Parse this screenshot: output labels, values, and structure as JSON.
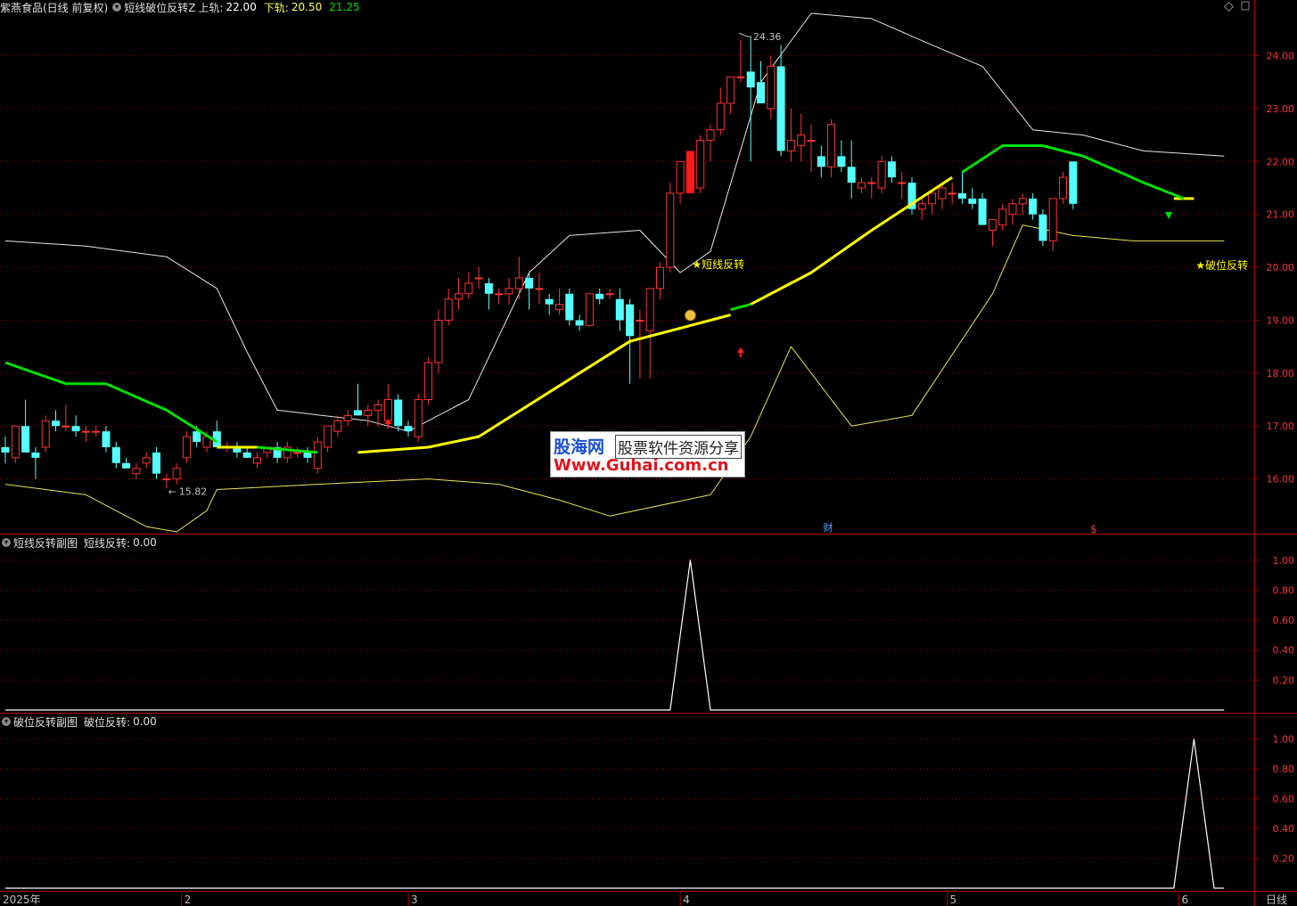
{
  "header": {
    "stock": "紫燕食品(日线 前复权)",
    "indicator": "短线破位反转Z",
    "upper_label": "上轨:",
    "upper_value": "22.00",
    "lower_label": "下轨:",
    "lower_value": "20.50",
    "mid_value": "21.25"
  },
  "sub1": {
    "title": "短线反转副图",
    "label": "短线反转:",
    "value": "0.00"
  },
  "sub2": {
    "title": "破位反转副图",
    "label": "破位反转:",
    "value": "0.00"
  },
  "annotations": {
    "high_label": "24.36",
    "low_label": "15.82",
    "signal1": "★短线反转",
    "signal2": "★破位反转",
    "cai": "财",
    "dollar": "$"
  },
  "timeline": {
    "year": "2025年",
    "months": [
      "2",
      "3",
      "4",
      "5",
      "6"
    ],
    "period": "日线"
  },
  "watermark": {
    "line1a": "股海网",
    "line1b": "股票软件资源分享",
    "line2": "Www.Guhai.com.cn"
  },
  "colors": {
    "up": "#ff3232",
    "down": "#54ffff",
    "grid": "#8b0000",
    "axis": "#b00000",
    "yellow": "#ffff00",
    "green": "#00e000"
  },
  "chart_data": [
    {
      "type": "candlestick",
      "ylim": [
        15.0,
        24.8
      ],
      "yticks": [
        16.0,
        17.0,
        18.0,
        19.0,
        20.0,
        21.0,
        22.0,
        23.0,
        24.0
      ],
      "candles": [
        [
          16.6,
          16.8,
          16.3,
          16.5
        ],
        [
          16.4,
          17.0,
          16.3,
          17.0
        ],
        [
          17.0,
          17.5,
          16.5,
          16.5
        ],
        [
          16.5,
          16.6,
          16.0,
          16.4
        ],
        [
          16.6,
          17.2,
          16.5,
          17.1
        ],
        [
          17.1,
          17.3,
          16.9,
          17.0
        ],
        [
          17.0,
          17.4,
          16.9,
          17.0
        ],
        [
          17.0,
          17.2,
          16.8,
          16.9
        ],
        [
          16.9,
          17.0,
          16.7,
          16.9
        ],
        [
          16.9,
          17.0,
          16.8,
          16.9
        ],
        [
          16.9,
          17.0,
          16.5,
          16.6
        ],
        [
          16.6,
          16.7,
          16.2,
          16.3
        ],
        [
          16.3,
          16.4,
          16.2,
          16.2
        ],
        [
          16.1,
          16.3,
          16.0,
          16.2
        ],
        [
          16.3,
          16.5,
          16.2,
          16.4
        ],
        [
          16.5,
          16.6,
          16.0,
          16.1
        ],
        [
          16.0,
          16.1,
          15.82,
          16.0
        ],
        [
          16.0,
          16.3,
          15.9,
          16.2
        ],
        [
          16.4,
          16.9,
          16.3,
          16.8
        ],
        [
          16.9,
          17.0,
          16.6,
          16.7
        ],
        [
          16.6,
          16.9,
          16.5,
          16.8
        ],
        [
          16.9,
          17.1,
          16.6,
          16.6
        ],
        [
          16.6,
          16.7,
          16.5,
          16.6
        ],
        [
          16.6,
          16.7,
          16.4,
          16.5
        ],
        [
          16.5,
          16.6,
          16.4,
          16.4
        ],
        [
          16.3,
          16.5,
          16.2,
          16.4
        ],
        [
          16.5,
          16.6,
          16.4,
          16.6
        ],
        [
          16.6,
          16.7,
          16.3,
          16.4
        ],
        [
          16.4,
          16.7,
          16.3,
          16.6
        ],
        [
          16.5,
          16.6,
          16.4,
          16.5
        ],
        [
          16.5,
          16.6,
          16.3,
          16.4
        ],
        [
          16.2,
          16.8,
          16.1,
          16.7
        ],
        [
          16.6,
          17.0,
          16.5,
          17.0
        ],
        [
          16.9,
          17.2,
          16.8,
          17.1
        ],
        [
          17.1,
          17.3,
          17.0,
          17.2
        ],
        [
          17.3,
          17.8,
          17.2,
          17.2
        ],
        [
          17.2,
          17.4,
          17.0,
          17.3
        ],
        [
          17.3,
          17.5,
          17.0,
          17.4
        ],
        [
          17.1,
          17.8,
          17.0,
          17.5
        ],
        [
          17.5,
          17.6,
          16.9,
          17.0
        ],
        [
          17.0,
          17.1,
          16.8,
          16.9
        ],
        [
          16.8,
          17.6,
          16.7,
          17.5
        ],
        [
          17.5,
          18.3,
          17.4,
          18.2
        ],
        [
          18.2,
          19.2,
          18.0,
          19.0
        ],
        [
          19.0,
          19.6,
          18.9,
          19.4
        ],
        [
          19.4,
          19.8,
          19.2,
          19.5
        ],
        [
          19.5,
          19.9,
          19.4,
          19.7
        ],
        [
          19.8,
          20.0,
          19.6,
          19.8
        ],
        [
          19.7,
          19.8,
          19.2,
          19.5
        ],
        [
          19.5,
          19.6,
          19.3,
          19.5
        ],
        [
          19.5,
          19.8,
          19.3,
          19.6
        ],
        [
          19.6,
          20.2,
          19.4,
          19.8
        ],
        [
          19.8,
          19.9,
          19.2,
          19.6
        ],
        [
          19.6,
          19.9,
          19.3,
          19.6
        ],
        [
          19.4,
          19.5,
          19.1,
          19.3
        ],
        [
          19.2,
          19.6,
          19.1,
          19.3
        ],
        [
          19.5,
          19.6,
          18.9,
          19.0
        ],
        [
          19.0,
          19.1,
          18.8,
          18.9
        ],
        [
          18.9,
          19.5,
          18.9,
          19.5
        ],
        [
          19.5,
          19.6,
          19.3,
          19.4
        ],
        [
          19.5,
          19.6,
          19.4,
          19.5
        ],
        [
          19.4,
          19.6,
          18.8,
          19.0
        ],
        [
          19.3,
          19.4,
          17.8,
          18.7
        ],
        [
          19.0,
          19.2,
          17.9,
          19.0
        ],
        [
          18.8,
          19.6,
          17.9,
          19.6
        ],
        [
          19.6,
          20.1,
          19.4,
          20.0
        ],
        [
          20.0,
          21.6,
          19.9,
          21.4
        ],
        [
          21.4,
          22.0,
          21.2,
          22.0
        ],
        [
          22.0,
          22.2,
          21.4,
          21.5
        ],
        [
          21.5,
          22.5,
          21.4,
          22.4
        ],
        [
          22.4,
          22.7,
          22.0,
          22.6
        ],
        [
          22.6,
          23.4,
          22.5,
          23.1
        ],
        [
          23.1,
          23.6,
          22.9,
          23.6
        ],
        [
          23.6,
          24.3,
          23.5,
          23.6
        ],
        [
          23.7,
          24.36,
          22.0,
          23.4
        ],
        [
          23.5,
          23.9,
          23.1,
          23.1
        ],
        [
          23.0,
          24.0,
          22.8,
          23.8
        ],
        [
          23.8,
          24.2,
          22.1,
          22.2
        ],
        [
          22.2,
          23.0,
          22.0,
          22.4
        ],
        [
          22.3,
          22.9,
          22.0,
          22.5
        ],
        [
          22.4,
          22.7,
          21.8,
          22.4
        ],
        [
          22.1,
          22.3,
          21.7,
          21.9
        ],
        [
          21.9,
          22.8,
          21.7,
          22.7
        ],
        [
          22.1,
          22.4,
          21.8,
          21.9
        ],
        [
          21.9,
          22.4,
          21.3,
          21.6
        ],
        [
          21.5,
          21.7,
          21.4,
          21.6
        ],
        [
          21.6,
          21.7,
          21.3,
          21.6
        ],
        [
          21.5,
          22.1,
          21.4,
          22.0
        ],
        [
          22.0,
          22.1,
          21.6,
          21.7
        ],
        [
          21.6,
          21.8,
          21.3,
          21.6
        ],
        [
          21.6,
          21.7,
          21.0,
          21.1
        ],
        [
          21.1,
          21.3,
          20.9,
          21.2
        ],
        [
          21.2,
          21.4,
          21.0,
          21.4
        ],
        [
          21.3,
          21.6,
          21.1,
          21.5
        ],
        [
          21.4,
          21.6,
          21.2,
          21.4
        ],
        [
          21.4,
          21.8,
          21.2,
          21.3
        ],
        [
          21.3,
          21.5,
          21.1,
          21.2
        ],
        [
          21.3,
          21.4,
          20.8,
          20.8
        ],
        [
          20.7,
          20.8,
          20.4,
          20.9
        ],
        [
          20.8,
          21.2,
          20.7,
          21.1
        ],
        [
          21.0,
          21.3,
          20.8,
          21.2
        ],
        [
          21.2,
          21.4,
          21.0,
          21.3
        ],
        [
          21.3,
          21.4,
          20.9,
          21.0
        ],
        [
          21.0,
          21.1,
          20.4,
          20.5
        ],
        [
          20.5,
          21.3,
          20.3,
          21.3
        ],
        [
          21.3,
          21.8,
          21.2,
          21.7
        ],
        [
          22.0,
          22.0,
          21.1,
          21.2
        ]
      ],
      "upper_band": [
        [
          0,
          20.5
        ],
        [
          8,
          20.4
        ],
        [
          16,
          20.2
        ],
        [
          21,
          19.6
        ],
        [
          24,
          18.4
        ],
        [
          27,
          17.3
        ],
        [
          36,
          17.1
        ],
        [
          40,
          16.9
        ],
        [
          46,
          17.5
        ],
        [
          52,
          19.9
        ],
        [
          56,
          20.6
        ],
        [
          63,
          20.7
        ],
        [
          67,
          19.9
        ],
        [
          70,
          20.3
        ],
        [
          75,
          23.5
        ],
        [
          80,
          24.8
        ],
        [
          86,
          24.7
        ],
        [
          92,
          24.2
        ],
        [
          97,
          23.8
        ],
        [
          102,
          22.6
        ],
        [
          107,
          22.5
        ],
        [
          113,
          22.2
        ],
        [
          121,
          22.1
        ]
      ],
      "lower_band": [
        [
          0,
          15.9
        ],
        [
          8,
          15.7
        ],
        [
          14,
          15.1
        ],
        [
          17,
          15.0
        ],
        [
          20,
          15.4
        ],
        [
          21,
          15.8
        ],
        [
          31,
          15.9
        ],
        [
          42,
          16.0
        ],
        [
          49,
          15.9
        ],
        [
          55,
          15.6
        ],
        [
          60,
          15.3
        ],
        [
          70,
          15.7
        ],
        [
          74,
          16.8
        ],
        [
          78,
          18.5
        ],
        [
          84,
          17.0
        ],
        [
          90,
          17.2
        ],
        [
          98,
          19.5
        ],
        [
          101,
          20.8
        ],
        [
          106,
          20.6
        ],
        [
          112,
          20.5
        ],
        [
          118,
          20.5
        ],
        [
          121,
          20.5
        ]
      ],
      "yellow_lines": [
        [
          [
            21,
            16.6
          ],
          [
            25,
            16.6
          ]
        ],
        [
          [
            35,
            16.5
          ],
          [
            42,
            16.6
          ],
          [
            47,
            16.8
          ],
          [
            57,
            18.0
          ],
          [
            62,
            18.6
          ],
          [
            68,
            18.9
          ],
          [
            72,
            19.1
          ]
        ],
        [
          [
            74,
            19.3
          ],
          [
            80,
            19.9
          ],
          [
            86,
            20.7
          ],
          [
            90,
            21.2
          ],
          [
            94,
            21.7
          ]
        ],
        [
          [
            116,
            21.3
          ],
          [
            118,
            21.3
          ]
        ]
      ],
      "green_lines": [
        [
          [
            0,
            18.2
          ],
          [
            6,
            17.8
          ],
          [
            10,
            17.8
          ],
          [
            16,
            17.3
          ],
          [
            21,
            16.7
          ]
        ],
        [
          [
            25,
            16.6
          ],
          [
            31,
            16.5
          ]
        ],
        [
          [
            72,
            19.2
          ],
          [
            74,
            19.3
          ]
        ],
        [
          [
            95,
            21.8
          ],
          [
            99,
            22.3
          ],
          [
            103,
            22.3
          ],
          [
            107,
            22.1
          ],
          [
            113,
            21.6
          ],
          [
            117,
            21.3
          ]
        ]
      ],
      "signals": {
        "short_reversal_bar": 68,
        "break_reversal_bar": 118
      }
    },
    {
      "type": "line",
      "series": [
        {
          "name": "短线反转",
          "values": [
            [
              0,
              0
            ],
            [
              66,
              0
            ],
            [
              68,
              1
            ],
            [
              70,
              0
            ],
            [
              121,
              0
            ]
          ]
        }
      ],
      "ylim": [
        0,
        1.1
      ],
      "yticks": [
        0.2,
        0.4,
        0.6,
        0.8,
        1.0
      ]
    },
    {
      "type": "line",
      "series": [
        {
          "name": "破位反转",
          "values": [
            [
              0,
              0
            ],
            [
              116,
              0
            ],
            [
              118,
              1
            ],
            [
              120,
              0
            ],
            [
              121,
              0
            ]
          ]
        }
      ],
      "ylim": [
        0,
        1.1
      ],
      "yticks": [
        0.2,
        0.4,
        0.6,
        0.8,
        1.0
      ]
    }
  ]
}
